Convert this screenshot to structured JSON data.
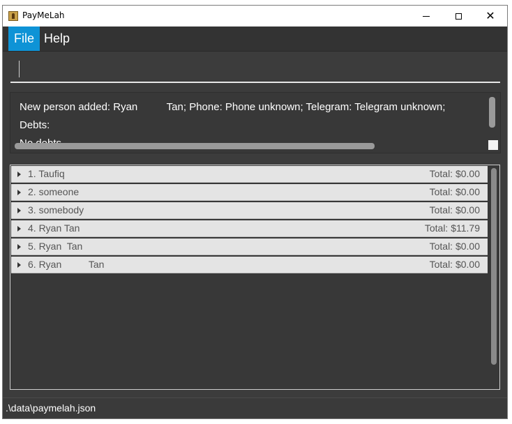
{
  "window": {
    "title": "PayMeLah"
  },
  "menu": {
    "file": "File",
    "help": "Help"
  },
  "command": {
    "value": ""
  },
  "result": {
    "line1": "New person added: Ryan          Tan; Phone: Phone unknown; Telegram: Telegram unknown;",
    "line2": "Debts:",
    "line3": "No debts"
  },
  "persons": [
    {
      "name": "1. Taufiq",
      "total": "Total: $0.00"
    },
    {
      "name": "2. someone",
      "total": "Total: $0.00"
    },
    {
      "name": "3. somebody",
      "total": "Total: $0.00"
    },
    {
      "name": "4. Ryan Tan",
      "total": "Total: $11.79"
    },
    {
      "name": "5. Ryan  Tan",
      "total": "Total: $0.00"
    },
    {
      "name": "6. Ryan          Tan",
      "total": "Total: $0.00"
    }
  ],
  "status": {
    "path": ".\\data\\paymelah.json"
  },
  "colors": {
    "accent": "#0e93d6",
    "background": "#3c3c3c"
  }
}
